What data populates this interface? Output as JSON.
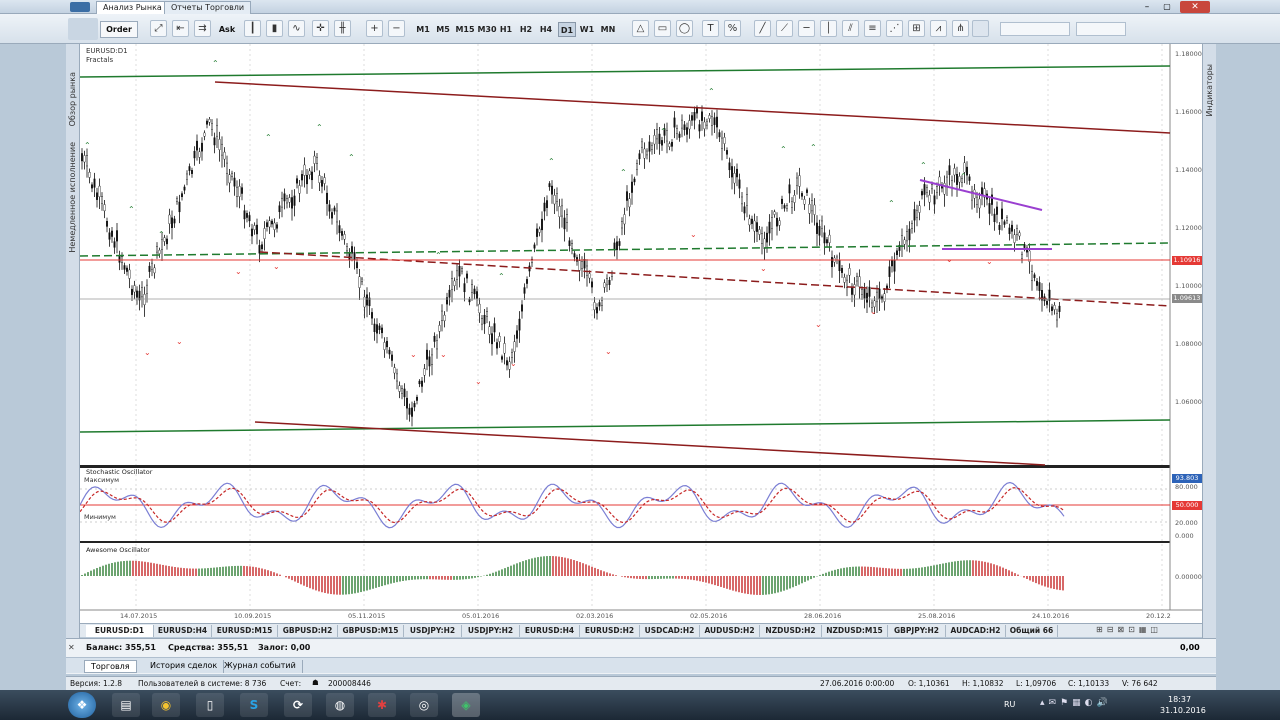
{
  "title_tabs": [
    "Анализ Рынка",
    "Отчеты Торговли"
  ],
  "toolbar": {
    "order_label": "Order",
    "ask_label": "Ask",
    "timeframes": [
      "M1",
      "M5",
      "M15",
      "M30",
      "H1",
      "H2",
      "H4",
      "D1",
      "W1",
      "MN"
    ],
    "active_timeframe": "D1"
  },
  "left_panel": {
    "market_watch": "Обзор рынка",
    "pending": "Немедленное исполнение"
  },
  "right_panel": {
    "indicators": "Индикаторы"
  },
  "chart": {
    "symbol": "EURUSD:D1",
    "fractals_label": "Fractals",
    "price_ticks": [
      "1.18000",
      "1.16000",
      "1.14000",
      "1.12000",
      "1.10000",
      "1.08000",
      "1.06000"
    ],
    "price_badge_red": "1.10916",
    "price_badge_gray": "1.09613",
    "date_ticks": [
      "14.07.2015",
      "10.09.2015",
      "05.11.2015",
      "05.01.2016",
      "02.03.2016",
      "02.05.2016",
      "28.06.2016",
      "25.08.2016",
      "24.10.2016",
      "20.12.2"
    ],
    "stochastic": {
      "label": "Stochastic Oscillator",
      "max_label": "Максимум",
      "min_label": "Минимум",
      "ticks": [
        "80.000",
        "20.000",
        "0.000"
      ],
      "badge_blue": "93.803",
      "badge_red": "50.000"
    },
    "awesome": {
      "label": "Awesome Oscillator",
      "tick": "0.00000"
    }
  },
  "symbol_tabs": [
    "EURUSD:D1",
    "EURUSD:H4",
    "EURUSD:M15",
    "GBPUSD:H2",
    "GBPUSD:M15",
    "USDJPY:H2",
    "USDJPY:H2",
    "EURUSD:H4",
    "EURUSD:H2",
    "USDCAD:H2",
    "AUDUSD:H2",
    "NZDUSD:H2",
    "NZDUSD:M15",
    "GBPJPY:H2",
    "AUDCAD:H2",
    "Общий 66"
  ],
  "active_symbol_tab": "EURUSD:D1",
  "terminal": {
    "balance": "Баланс: 355,51",
    "equity": "Средства: 355,51",
    "margin": "Залог: 0,00",
    "right_value": "0,00",
    "tabs": [
      "Торговля",
      "История сделок",
      "Журнал событий"
    ]
  },
  "status_bar": {
    "version": "Версия: 1.2.8",
    "users": "Пользователей в системе: 8 736",
    "account_label": "Счет:",
    "account": "200008446",
    "datetime": "27.06.2016 0:00:00",
    "open": "O: 1,10361",
    "high": "H: 1,10832",
    "low": "L: 1,09706",
    "close": "C: 1,10133",
    "volume": "V: 76 642"
  },
  "taskbar": {
    "lang": "RU",
    "time": "18:37",
    "date": "31.10.2016"
  },
  "colors": {
    "green": "#1f7a2e",
    "maroon": "#8c1c1c",
    "red": "#e53935",
    "purple": "#9a3fd0",
    "stoch_blue": "#7b7fd4"
  }
}
